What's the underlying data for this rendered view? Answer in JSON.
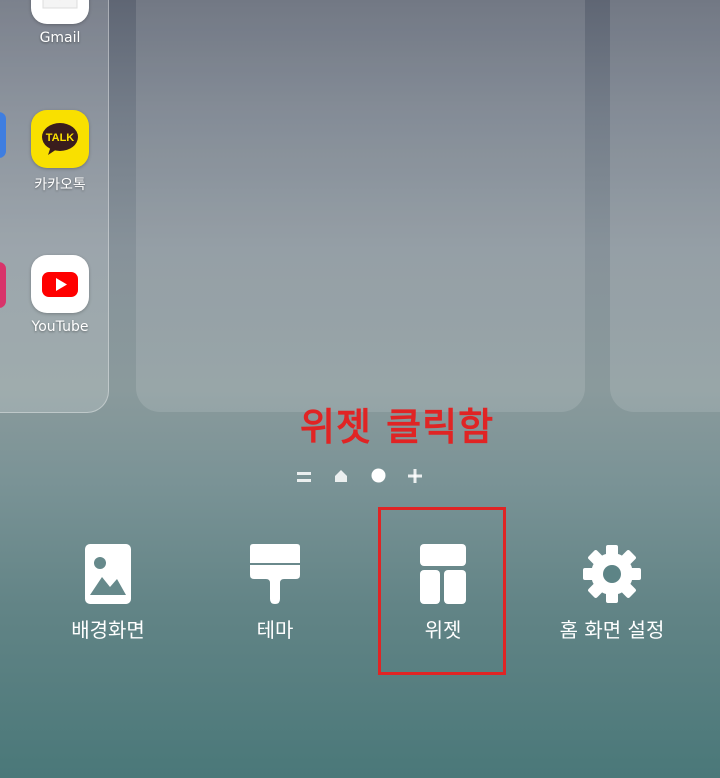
{
  "apps": [
    {
      "label": "Gmail",
      "icon": "gmail-icon"
    },
    {
      "label": "카카오톡",
      "icon": "kakaotalk-icon",
      "badge_text": "TALK"
    },
    {
      "label": "YouTube",
      "icon": "youtube-icon"
    }
  ],
  "annotation": "위젯 클릭함",
  "menu": [
    {
      "label": "배경화면",
      "icon": "wallpaper-icon"
    },
    {
      "label": "테마",
      "icon": "theme-brush-icon"
    },
    {
      "label": "위젯",
      "icon": "widgets-icon"
    },
    {
      "label": "홈 화면 설정",
      "icon": "gear-icon"
    }
  ],
  "pager": [
    "list-indicator-icon",
    "home-indicator-icon",
    "current-page-dot",
    "add-page-icon"
  ],
  "colors": {
    "annotation": "#e02424",
    "kakao_yellow": "#f9e000",
    "youtube_red": "#ff0000"
  }
}
